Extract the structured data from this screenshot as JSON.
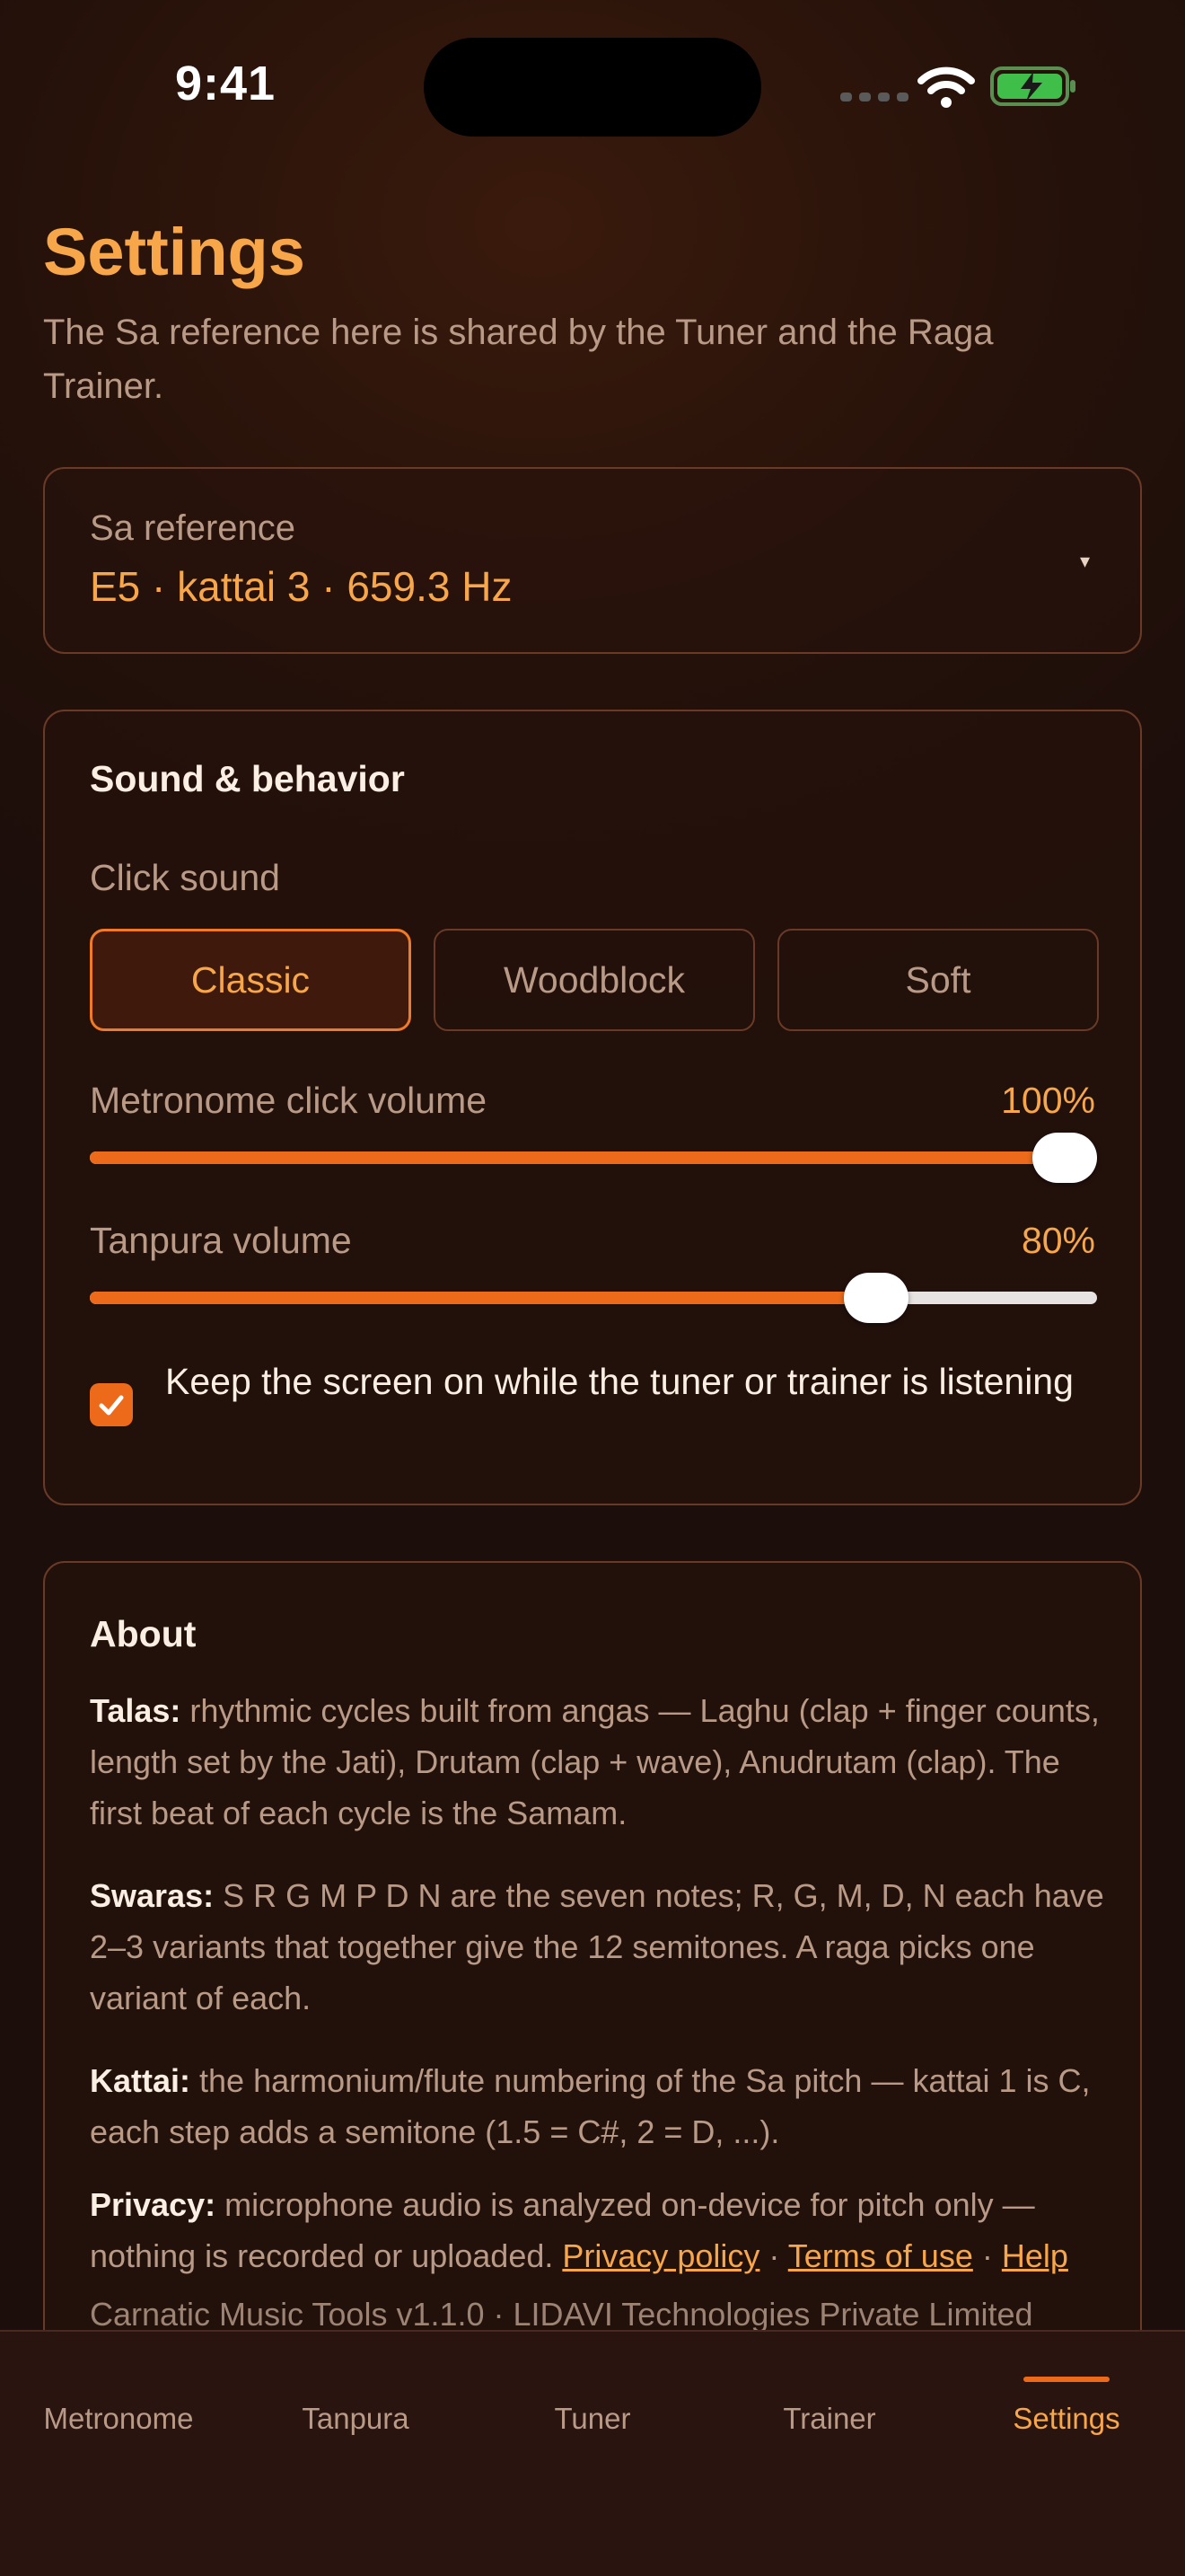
{
  "status_bar": {
    "time": "9:41",
    "icons": [
      "signal-icon",
      "wifi-icon",
      "battery-charging-icon"
    ]
  },
  "header": {
    "title": "Settings",
    "subtitle": "The Sa reference here is shared by the Tuner and the Raga Trainer."
  },
  "sa_reference": {
    "label": "Sa reference",
    "value": "E5 · kattai 3 · 659.3 Hz",
    "caret": "▾"
  },
  "sound": {
    "heading": "Sound & behavior",
    "click_label": "Click sound",
    "options": [
      "Classic",
      "Woodblock",
      "Soft"
    ],
    "selected": "Classic",
    "metronome_label": "Metronome click volume",
    "metronome_value": "100%",
    "metronome_fraction": 1.0,
    "tanpura_label": "Tanpura volume",
    "tanpura_value": "80%",
    "tanpura_fraction": 0.8,
    "keep_screen_label": "Keep the screen on while the tuner or trainer is listening",
    "keep_screen_checked": true
  },
  "about": {
    "heading": "About",
    "talas_term": "Talas:",
    "talas_text": " rhythmic cycles built from angas — Laghu (clap + finger counts, length set by the Jati), Drutam (clap + wave), Anudrutam (clap). The first beat of each cycle is the Samam.",
    "swaras_term": "Swaras:",
    "swaras_text": " S R G M P D N are the seven notes; R, G, M, D, N each have 2–3 variants that together give the 12 semitones. A raga picks one variant of each.",
    "kattai_term": "Kattai:",
    "kattai_text": " the harmonium/flute numbering of the Sa pitch — kattai 1 is C, each step adds a semitone (1.5 = C#, 2 = D, ...).",
    "privacy_term": "Privacy:",
    "privacy_text": " microphone audio is analyzed on-device for pitch only — nothing is recorded or uploaded. ",
    "privacy_link": "Privacy policy",
    "sep": " · ",
    "terms_link": "Terms of use",
    "help_link": "Help",
    "footer": "Carnatic Music Tools v1.1.0 · LIDAVI Technologies Private Limited"
  },
  "tabs": [
    "Metronome",
    "Tanpura",
    "Tuner",
    "Trainer",
    "Settings"
  ],
  "active_tab": "Settings",
  "colors": {
    "accent": "#f7a64a",
    "accent_strong": "#ec6a1a",
    "background": "#24110a"
  }
}
